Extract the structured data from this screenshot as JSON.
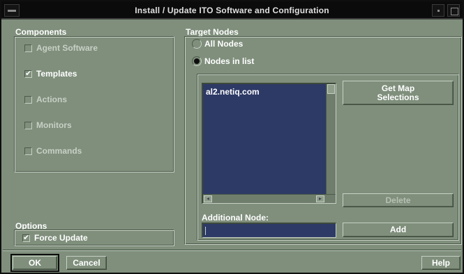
{
  "window": {
    "title": "Install / Update ITO Software and Configuration"
  },
  "components": {
    "label": "Components",
    "items": [
      {
        "label": "Agent Software",
        "checked": false
      },
      {
        "label": "Templates",
        "checked": true
      },
      {
        "label": "Actions",
        "checked": false
      },
      {
        "label": "Monitors",
        "checked": false
      },
      {
        "label": "Commands",
        "checked": false
      }
    ]
  },
  "options": {
    "label": "Options",
    "force_update": {
      "label": "Force Update",
      "checked": true
    }
  },
  "target_nodes": {
    "label": "Target Nodes",
    "all_nodes": {
      "label": "All Nodes",
      "selected": false
    },
    "nodes_in_list": {
      "label": "Nodes in list",
      "selected": true
    },
    "list_items": [
      "al2.netiq.com"
    ],
    "get_map_selections_label": "Get Map Selections",
    "delete_label": "Delete",
    "additional_node_label": "Additional Node:",
    "additional_node_value": "",
    "add_label": "Add"
  },
  "footer": {
    "ok_label": "OK",
    "cancel_label": "Cancel",
    "help_label": "Help"
  },
  "colors": {
    "dialog_bg": "#7f8f7c",
    "list_bg": "#2d3a66",
    "titlebar_bg": "#0b0b0b"
  }
}
